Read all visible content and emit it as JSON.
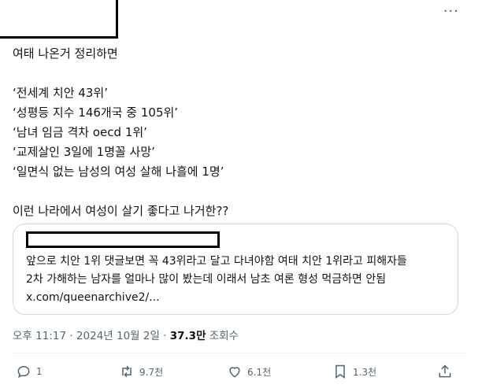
{
  "tweet": {
    "lines": [
      "여태 나온거 정리하면",
      "",
      "‘전세계 치안 43위’",
      "‘성평등 지수 146개국 중 105위’",
      "‘남녀 임금 격차 oecd 1위’",
      "‘교제살인 3일에 1명꼴 사망’",
      "‘일면식 없는 남성의 여성 살해 나흘에 1명’",
      "",
      "이런 나라에서 여성이 살기 좋다고 나거한??"
    ]
  },
  "quote": {
    "text_line1": "앞으로 치안 1위 댓글보면 꼭 43위라고 달고 다녀야함 여태 치안 1위라고 피해자들",
    "text_line2": "2차 가해하는 남자를 얼마나 많이 봤는데 이래서 남초 여론 형성 먹금하면 안됨",
    "link": "x.com/queenarchive2/..."
  },
  "meta": {
    "time": "오후 11:17",
    "sep": " · ",
    "date": "2024년 10월 2일",
    "views_count": "37.3만",
    "views_label": " 조회수"
  },
  "actions": {
    "reply_count": "1",
    "retweet_count": "9.7천",
    "like_count": "6.1천",
    "bookmark_count": "1.3천"
  },
  "header": {
    "more_label": "···"
  }
}
